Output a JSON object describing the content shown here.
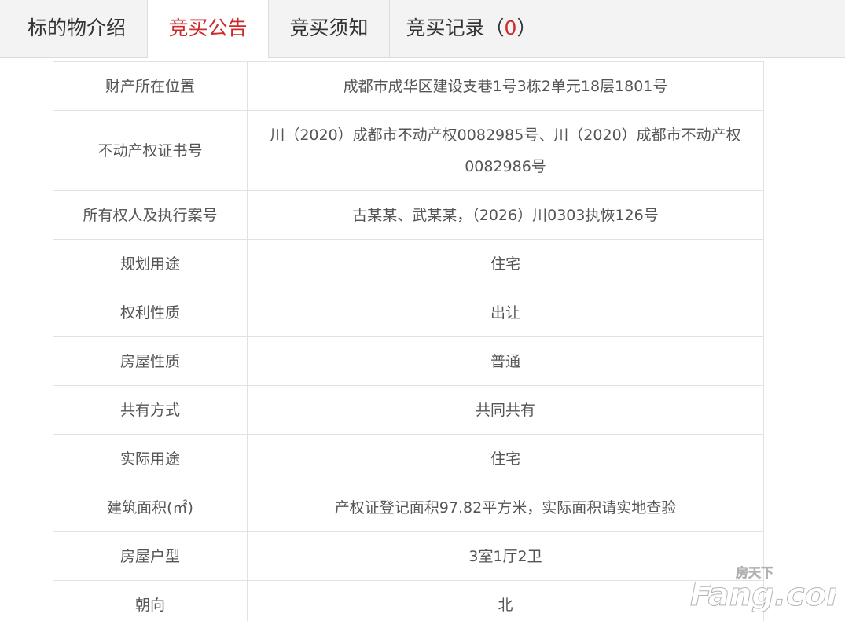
{
  "tabs": [
    {
      "label": "标的物介绍",
      "active": false
    },
    {
      "label": "竞买公告",
      "active": true
    },
    {
      "label": "竞买须知",
      "active": false
    },
    {
      "label": "竞买记录（",
      "count": "0",
      "suffix": "）",
      "active": false
    }
  ],
  "rows": [
    {
      "label": "财产所在位置",
      "value": "成都市成华区建设支巷1号3栋2单元18层1801号"
    },
    {
      "label": "不动产权证书号",
      "value": "川（2020）成都市不动产权0082985号、川（2020）成都市不动产权0082986号"
    },
    {
      "label": "所有权人及执行案号",
      "value": "古某某、武某某，（2026）川0303执恢126号"
    },
    {
      "label": "规划用途",
      "value": "住宅"
    },
    {
      "label": "权利性质",
      "value": "出让"
    },
    {
      "label": "房屋性质",
      "value": "普通"
    },
    {
      "label": "共有方式",
      "value": "共同共有"
    },
    {
      "label": "实际用途",
      "value": "住宅"
    },
    {
      "label": "建筑面积(㎡)",
      "value": "产权证登记面积97.82平方米，实际面积请实地查验"
    },
    {
      "label": "房屋户型",
      "value": "3室1厅2卫"
    },
    {
      "label": "朝向",
      "value": "北"
    }
  ],
  "watermark": {
    "logo_text": "Fang.com",
    "logo_cn": "房天下",
    "color": "#ffffff"
  },
  "colors": {
    "accent": "#cc2b2b",
    "text": "#555555",
    "border": "#e2e2e2"
  }
}
